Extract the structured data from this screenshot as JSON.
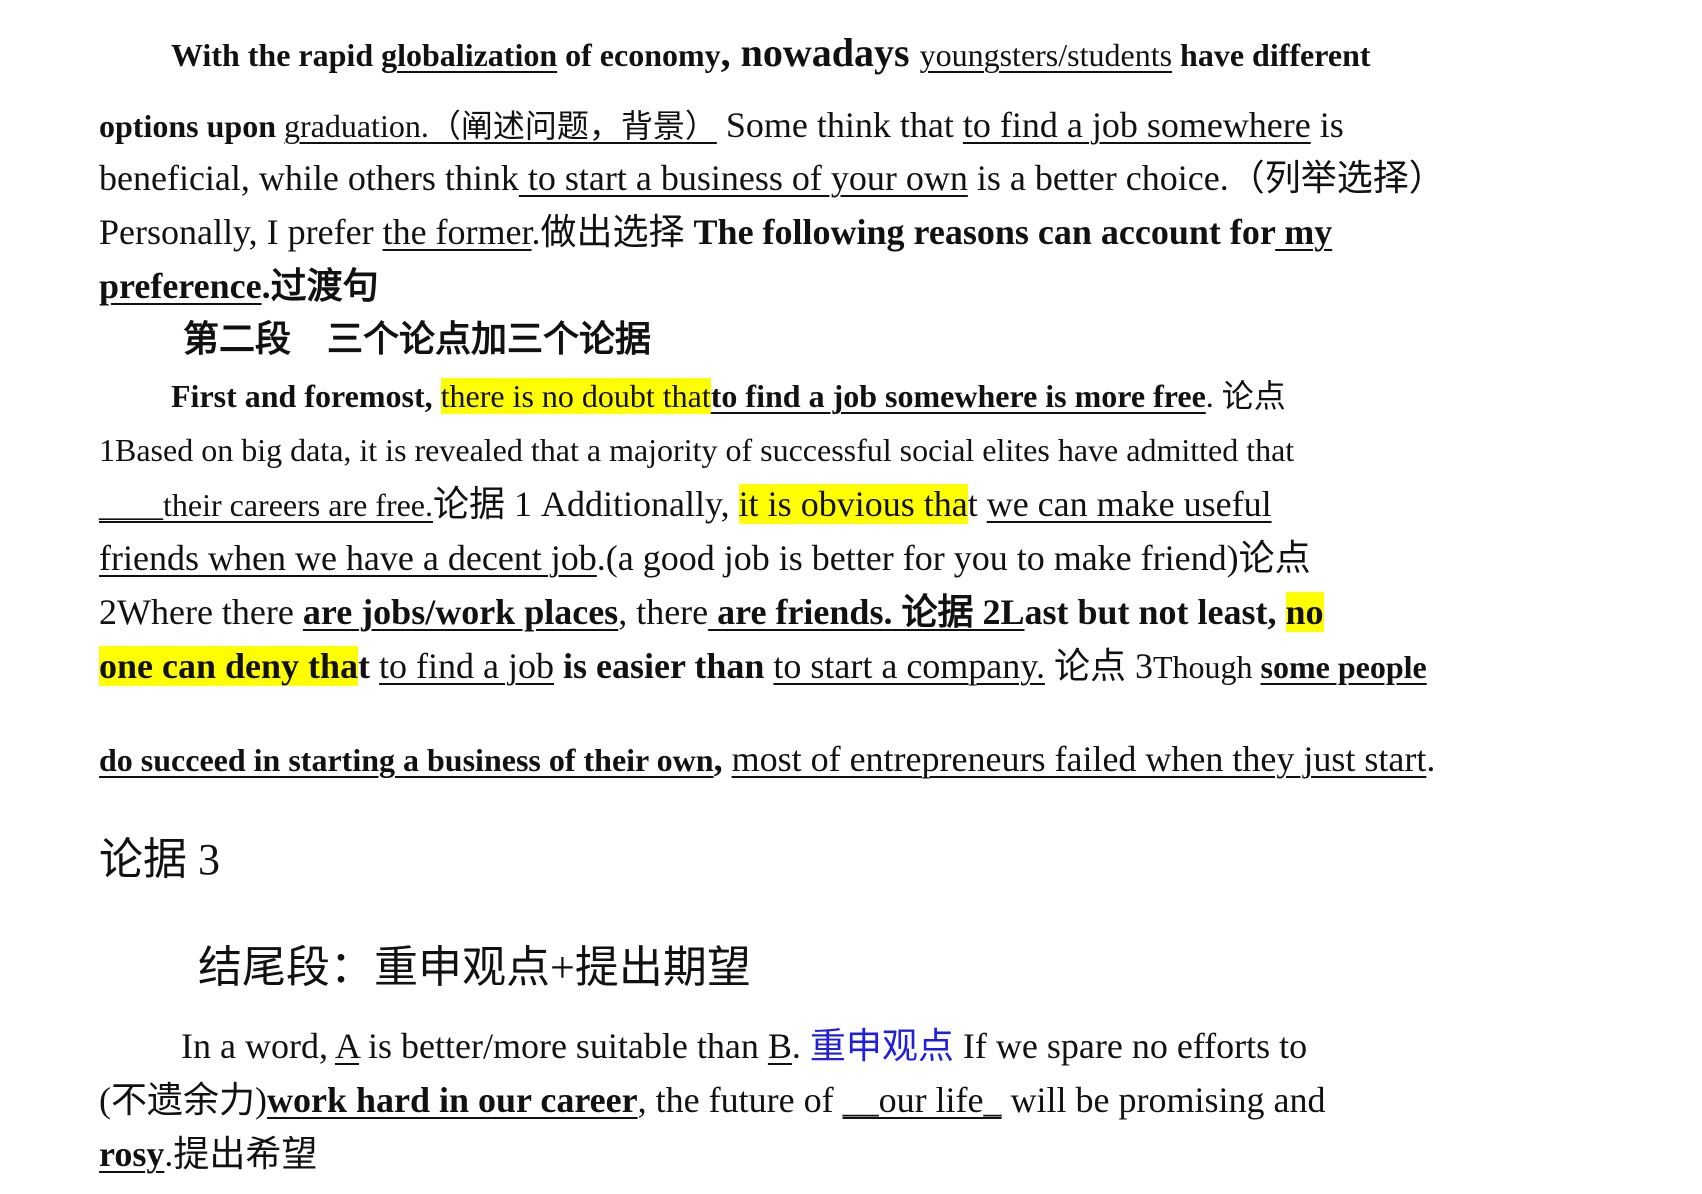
{
  "intro": {
    "l1": {
      "a": "With the rapid ",
      "b": "globalization",
      "c": " of economy",
      "d": ", nowadays ",
      "e": "youngsters/students",
      "f": " have different"
    },
    "l2": {
      "a": "options upon ",
      "b": "graduation.（阐述问题，背景）",
      "c": " Some think that ",
      "d": "to find a job somewhere",
      "e": " is"
    },
    "l3": {
      "a": "beneficial, while others think",
      "b": " to start a business of your own",
      "c": " is a better choice.（列举选择）"
    },
    "l4": {
      "a": "Personally, I prefer ",
      "b": "the former",
      "c": ".做出选择 ",
      "d": "The following reasons can account for",
      "e": " my"
    },
    "l5": {
      "a": "preference",
      "b": ".过渡句"
    }
  },
  "section2": {
    "heading": "第二段　三个论点加三个论据"
  },
  "body": {
    "l1": {
      "a": "First and foremost, ",
      "b": "there is no doubt that",
      "c": "to find a job somewhere is more free",
      "d": ".  论点"
    },
    "l2": {
      "a": "1Based on big data, it is revealed that a majority of successful social elites have admitted that"
    },
    "l3": {
      "a": "____their careers are free.",
      "b": "论据 1",
      "c": "    Additionally, ",
      "d": " it is obvious tha",
      "e": "t ",
      "f": "we can make useful"
    },
    "l4": {
      "a": "friends when we have a decent job",
      "b": ".(a good job is better for you to make friend)论点"
    },
    "l5": {
      "a": "2Where there ",
      "b": "are jobs/work places",
      "c": ", there",
      "d": " are friends.  论据 2L",
      "e": "ast but not least, ",
      "f": "no"
    },
    "l6": {
      "a": "one can deny tha",
      "b": "t ",
      "c": "to find a job",
      "d": " is easier than ",
      "e": "to start a company.",
      "f": "  论点 3",
      "g": "Though ",
      "h": "some people"
    },
    "l7": {
      "a": "do succeed in starting a business of their own",
      "b": ",  ",
      "c": "most of entrepreneurs failed when they just start",
      "d": "."
    },
    "evidence3": "论据 3"
  },
  "conclusion": {
    "heading": "结尾段：重申观点+提出期望",
    "l1": {
      "a": "In a word, ",
      "b": "A",
      "c": " is better/more suitable than ",
      "d": "B",
      "e": ".  ",
      "f": "重申观点",
      "g": " If we spare no efforts to"
    },
    "l2": {
      "a": "(不遗余力)",
      "b": "work hard in our career",
      "c": ", the future of ",
      "d": "__our life_",
      "e": " will be promising and"
    },
    "l3": {
      "a": "rosy",
      "b": ".提出希望"
    }
  },
  "colors": {
    "highlight": "#ffff00",
    "blue_text": "#1f1fe0",
    "text": "#111111"
  }
}
